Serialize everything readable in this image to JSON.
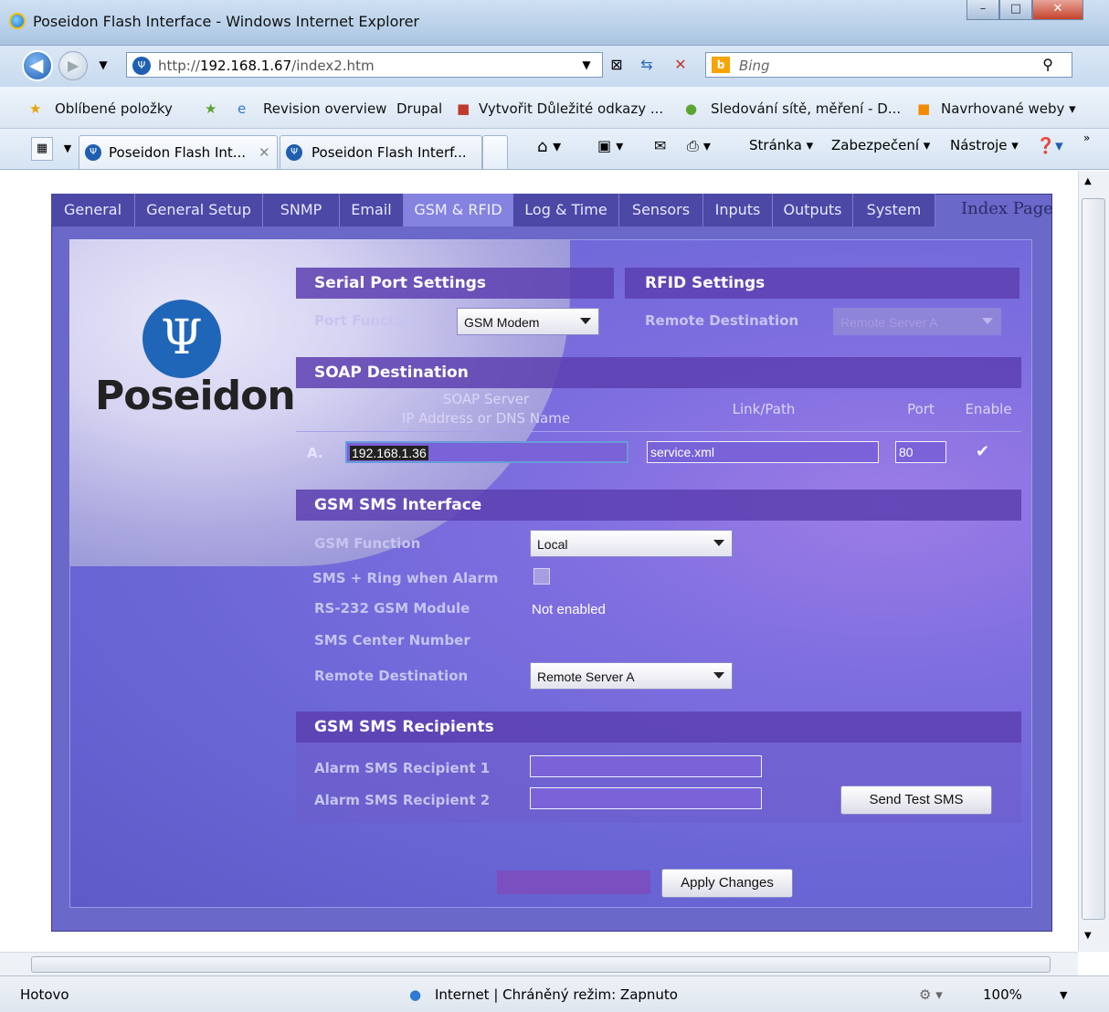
{
  "window": {
    "title": "Poseidon Flash Interface - Windows Internet Explorer",
    "min": "–",
    "max": "□",
    "close": "✕"
  },
  "address": {
    "prefix": "http://",
    "host": "192.168.1.67",
    "path": "/index2.htm"
  },
  "search": {
    "placeholder": "Bing"
  },
  "favorites": {
    "items": [
      "Oblíbené položky",
      "Revision overview",
      "Drupal",
      "Vytvořit Důležité odkazy ...",
      "Sledování sítě, měření - D...",
      "Navrhované weby ▾"
    ]
  },
  "browser_tabs": [
    "Poseidon Flash Int...",
    "Poseidon Flash Interf..."
  ],
  "commands": {
    "page": "Stránka ▾",
    "security": "Zabezpečení ▾",
    "tools": "Nástroje ▾"
  },
  "app": {
    "tabs": [
      "General",
      "General Setup",
      "SNMP",
      "Email",
      "GSM & RFID",
      "Log & Time",
      "Sensors",
      "Inputs",
      "Outputs",
      "System"
    ],
    "active_tab": "GSM & RFID",
    "index_page": "Index Page",
    "logo": "Poseidon",
    "serial": {
      "title": "Serial Port Settings",
      "port_function_label": "Port Function",
      "port_function_value": "GSM Modem"
    },
    "rfid": {
      "title": "RFID Settings",
      "remote_dest_label": "Remote Destination",
      "remote_dest_value": "Remote Server A"
    },
    "soap": {
      "title": "SOAP Destination",
      "col_server_1": "SOAP Server",
      "col_server_2": "IP Address or DNS Name",
      "col_path": "Link/Path",
      "col_port": "Port",
      "col_enable": "Enable",
      "row_label": "A.",
      "server": "192.168.1.36",
      "path": "service.xml",
      "port": "80",
      "enabled": "✔"
    },
    "gsm": {
      "title": "GSM SMS Interface",
      "function_label": "GSM Function",
      "function_value": "Local",
      "ring_label": "SMS + Ring when Alarm",
      "module_label": "RS-232 GSM Module",
      "module_value": "Not enabled",
      "center_label": "SMS Center Number",
      "dest_label": "Remote Destination",
      "dest_value": "Remote Server A"
    },
    "recipients": {
      "title": "GSM SMS Recipients",
      "r1_label": "Alarm SMS Recipient 1",
      "r2_label": "Alarm SMS Recipient 2",
      "r1_value": "",
      "r2_value": "",
      "test_button": "Send Test SMS"
    },
    "apply_button": "Apply Changes"
  },
  "status": {
    "left": "Hotovo",
    "zone": "Internet | Chráněný režim: Zapnuto",
    "zoom": "100%"
  }
}
